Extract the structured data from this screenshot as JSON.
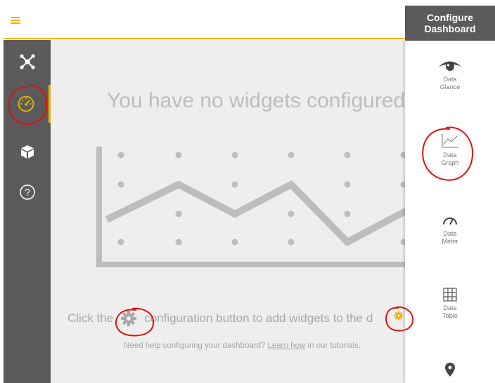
{
  "nav": {
    "items": [
      {
        "name": "network-icon"
      },
      {
        "name": "dashboard-meter-icon"
      },
      {
        "name": "cube-icon"
      },
      {
        "name": "help-icon",
        "glyph": "?"
      }
    ],
    "active_index": 1
  },
  "main": {
    "headline": "You have no widgets configured",
    "cta_before": "Click the",
    "cta_after": "configuration button to add widgets to the d",
    "help_before": "Need help configuring your dashboard?",
    "help_link": "Learn how",
    "help_after": " in our tutorials."
  },
  "panel": {
    "title_line1": "Configure",
    "title_line2": "Dashboard",
    "widgets": [
      {
        "line1": "Data",
        "line2": "Glance",
        "icon": "eye-icon"
      },
      {
        "line1": "Data",
        "line2": "Graph",
        "icon": "line-graph-icon"
      },
      {
        "line1": "Data",
        "line2": "Meter",
        "icon": "gauge-icon"
      },
      {
        "line1": "Data",
        "line2": "Table",
        "icon": "table-grid-icon"
      },
      {
        "icon": "map-pin-icon"
      }
    ]
  },
  "colors": {
    "accent": "#f0b400",
    "sidebar": "#5b5b5b",
    "canvas": "#eeeeee",
    "annotation": "#e01010"
  }
}
